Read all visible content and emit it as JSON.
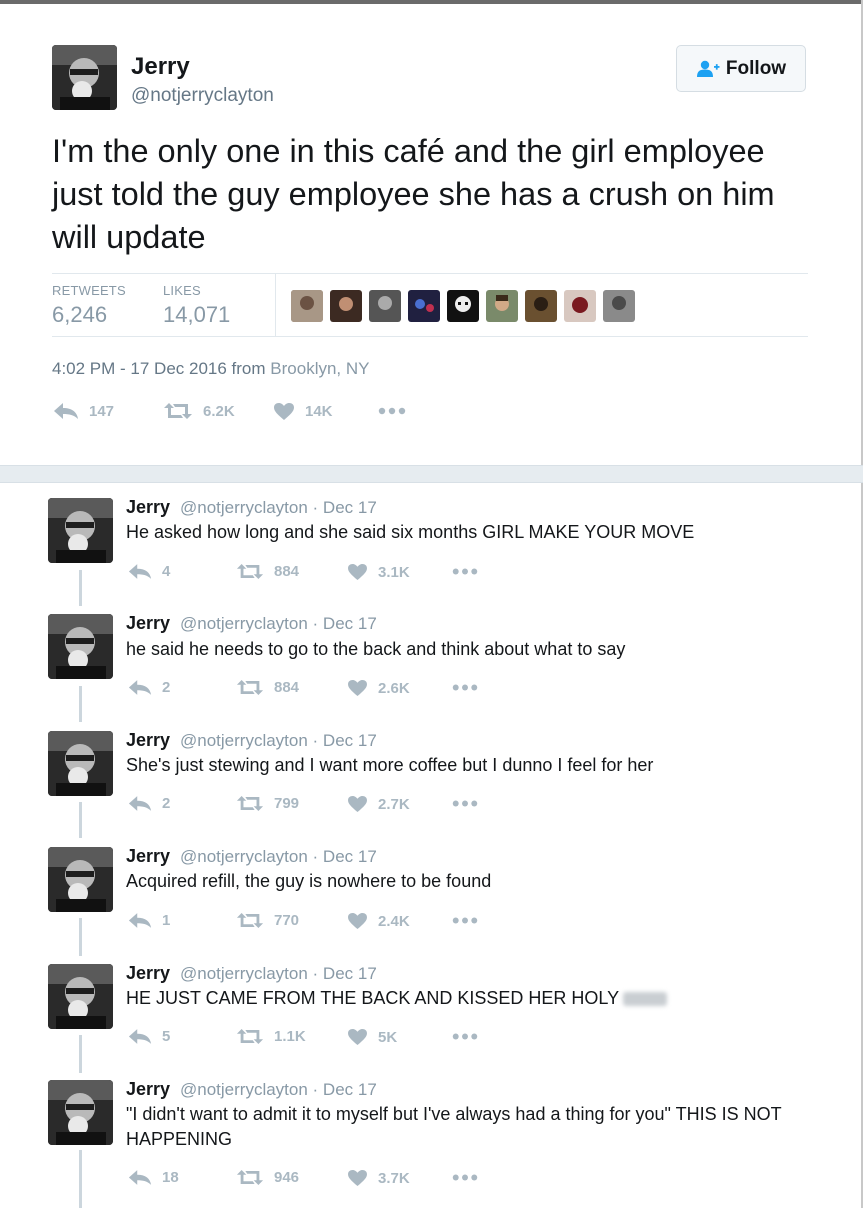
{
  "main_tweet": {
    "name": "Jerry",
    "handle": "@notjerryclayton",
    "follow_label": "Follow",
    "text": "I'm the only one in this café and the girl employee just told the guy employee she has a crush on him will update",
    "retweets_label": "RETWEETS",
    "retweets_value": "6,246",
    "likes_label": "LIKES",
    "likes_value": "14,071",
    "time": "4:02 PM - 17 Dec 2016 from",
    "location": "Brooklyn, NY",
    "actions": {
      "reply": "147",
      "retweet": "6.2K",
      "like": "14K"
    }
  },
  "replies": [
    {
      "name": "Jerry",
      "meta": "@notjerryclayton · Dec 17",
      "text": "He asked how long and she said six months GIRL MAKE YOUR MOVE",
      "reply": "4",
      "retweet": "884",
      "like": "3.1K"
    },
    {
      "name": "Jerry",
      "meta": "@notjerryclayton · Dec 17",
      "text": "he said he needs to go to the back and think about what to say",
      "reply": "2",
      "retweet": "884",
      "like": "2.6K"
    },
    {
      "name": "Jerry",
      "meta": "@notjerryclayton · Dec 17",
      "text": "She's just stewing and I want more coffee but I dunno I feel for her",
      "reply": "2",
      "retweet": "799",
      "like": "2.7K"
    },
    {
      "name": "Jerry",
      "meta": "@notjerryclayton · Dec 17",
      "text": "Acquired refill, the guy is nowhere to be found",
      "reply": "1",
      "retweet": "770",
      "like": "2.4K"
    },
    {
      "name": "Jerry",
      "meta": "@notjerryclayton · Dec 17",
      "text": "HE JUST CAME FROM THE BACK AND KISSED HER HOLY",
      "reply": "5",
      "retweet": "1.1K",
      "like": "5K"
    },
    {
      "name": "Jerry",
      "meta": "@notjerryclayton · Dec 17",
      "text": "\"I didn't want to admit it to myself but I've always had a thing for you\" THIS IS NOT HAPPENING",
      "reply": "18",
      "retweet": "946",
      "like": "3.7K"
    }
  ],
  "colors": {
    "text": "#14171a",
    "muted": "#657786",
    "icon": "#aab8c2",
    "follow_icon": "#1da1f2"
  }
}
